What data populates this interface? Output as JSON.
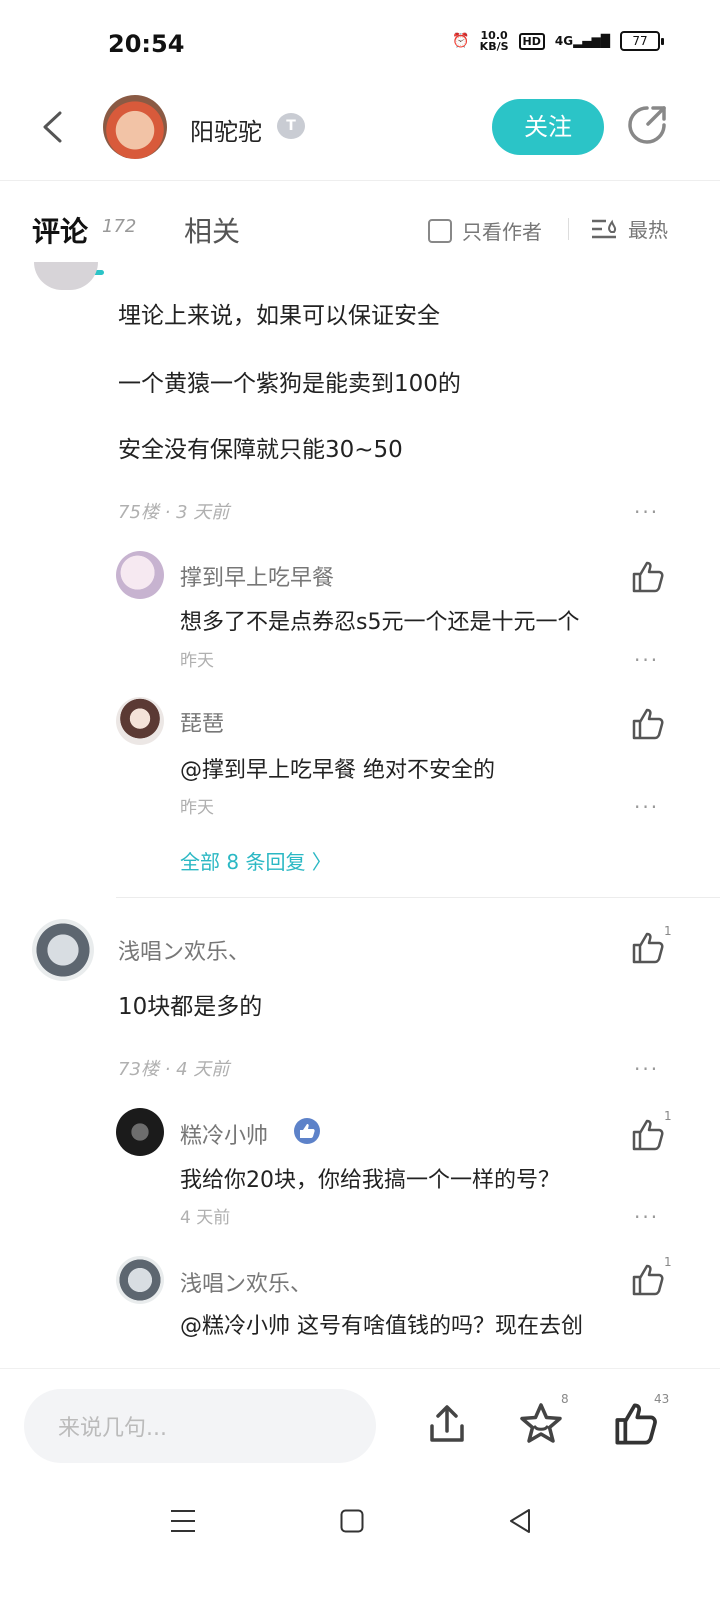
{
  "status": {
    "time": "20:54",
    "speed_value": "10.0",
    "speed_unit": "KB/S",
    "hd": "HD",
    "network": "4G",
    "battery": "77"
  },
  "header": {
    "author": "阳驼驼",
    "level": "T",
    "follow_label": "关注"
  },
  "tabs": {
    "comments_label": "评论",
    "comments_count": "172",
    "related_label": "相关",
    "only_author_label": "只看作者",
    "sort_label": "最热"
  },
  "main_post": {
    "lines": [
      "埋论上来说，如果可以保证安全",
      "一个黄猿一个紫狗是能卖到100的",
      "安全没有保障就只能30~50"
    ],
    "meta": "75楼 · 3 天前",
    "more": "···"
  },
  "replies_a": [
    {
      "user": "撑到早上吃早餐",
      "text": "想多了不是点券忍s5元一个还是十元一个",
      "time": "昨天"
    },
    {
      "user": "琵琶",
      "text": "@撑到早上吃早餐 绝对不安全的",
      "time": "昨天"
    }
  ],
  "view_all_label": "全部 8 条回复 〉",
  "comment2": {
    "user": "浅唱ン欢乐、",
    "text": "10块都是多的",
    "meta": "73楼 · 4 天前",
    "likes": "1"
  },
  "replies_b": [
    {
      "user": "糕冷小帅",
      "text": "我给你20块，你给我搞一个一样的号？",
      "time": "4 天前",
      "likes": "1"
    },
    {
      "user": "浅唱ン欢乐、",
      "text": "@糕冷小帅 这号有啥值钱的吗？现在去创",
      "likes": "1"
    }
  ],
  "bottom": {
    "input_placeholder": "来说几句...",
    "favorite_count": "8",
    "like_count": "43"
  }
}
